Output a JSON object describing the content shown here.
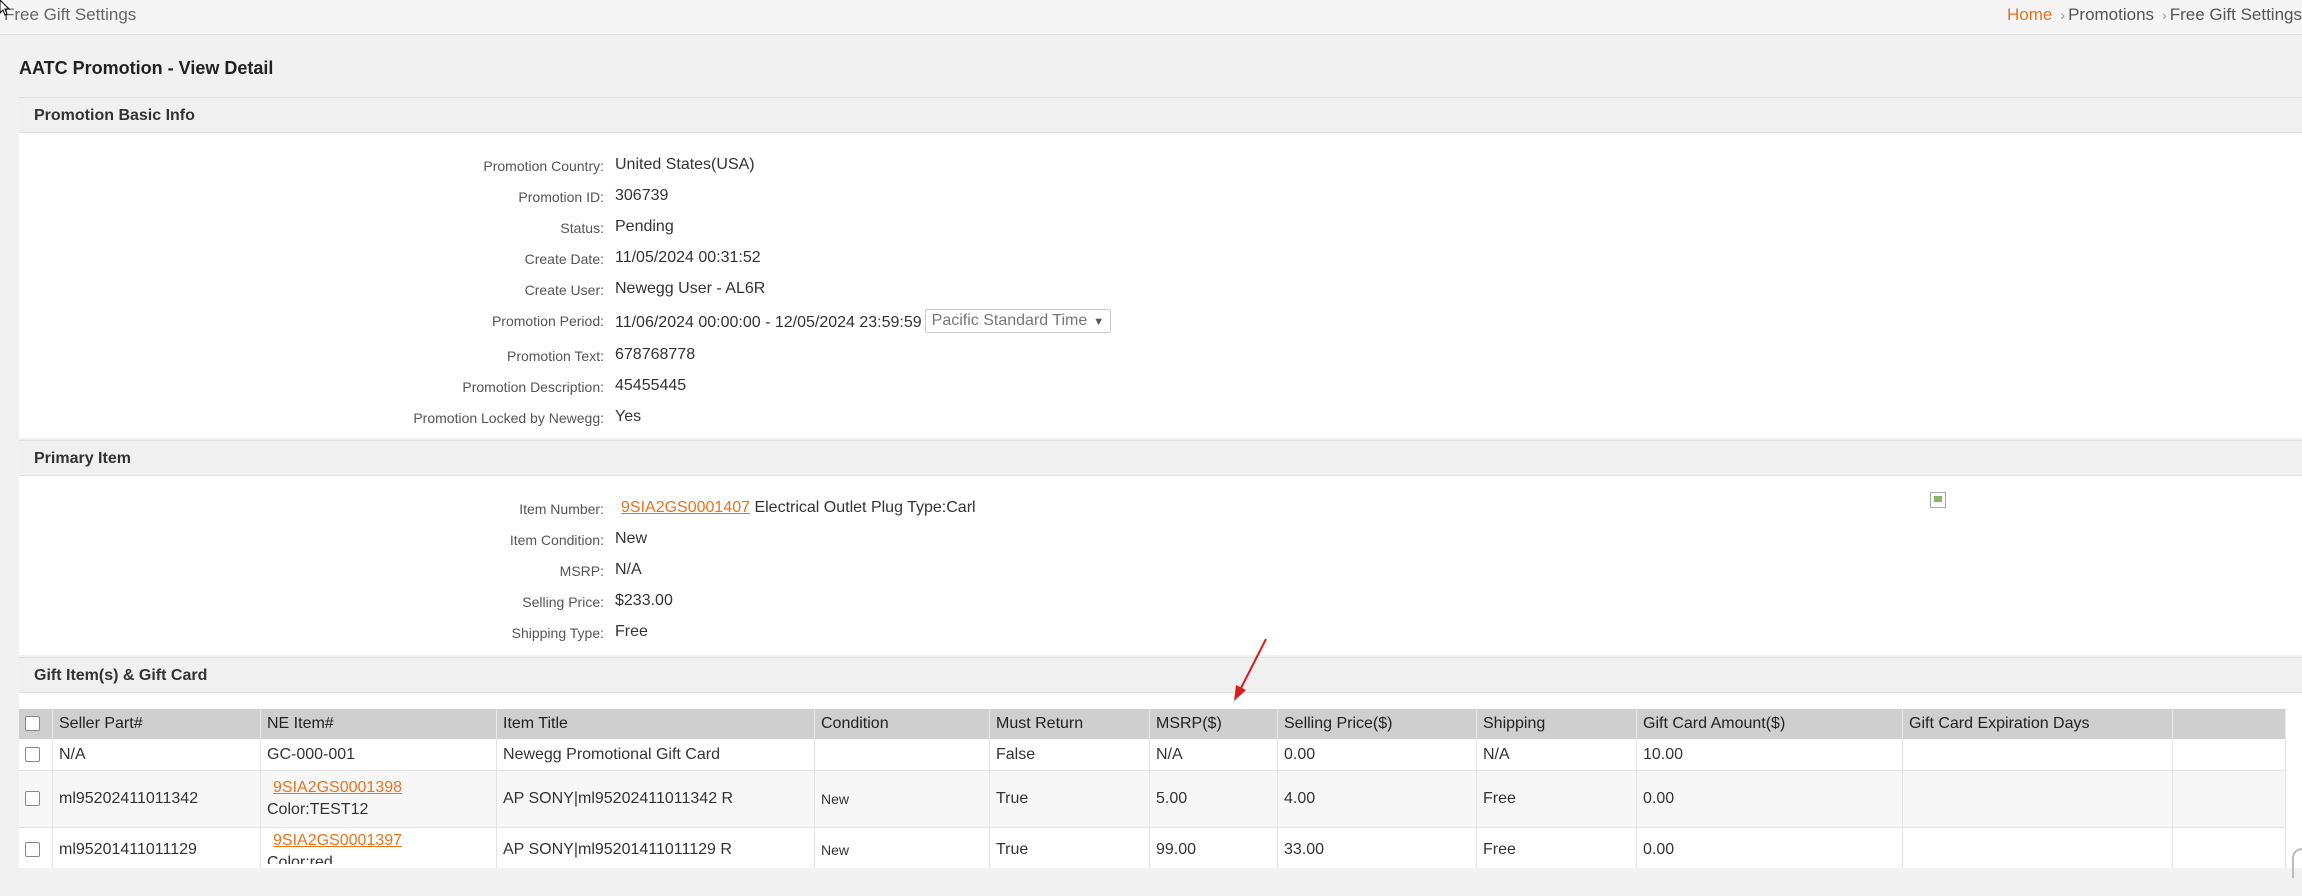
{
  "top": {
    "page_name": "Free Gift Settings",
    "breadcrumb": {
      "home": "Home",
      "promotions": "Promotions",
      "current": "Free Gift Settings"
    }
  },
  "page_title": "AATC Promotion - View Detail",
  "basic_info": {
    "header": "Promotion Basic Info",
    "fields": [
      {
        "label": "Promotion Country:",
        "value": "United States(USA)"
      },
      {
        "label": "Promotion ID:",
        "value": "306739"
      },
      {
        "label": "Status:",
        "value": "Pending"
      },
      {
        "label": "Create Date:",
        "value": "11/05/2024 00:31:52"
      },
      {
        "label": "Create User:",
        "value": "Newegg User - AL6R"
      },
      {
        "label": "Promotion Period:",
        "value": "11/06/2024 00:00:00 - 12/05/2024 23:59:59"
      },
      {
        "label": "Promotion Text:",
        "value": "678768778"
      },
      {
        "label": "Promotion Description:",
        "value": "45455445"
      },
      {
        "label": "Promotion Locked by Newegg:",
        "value": "Yes"
      }
    ],
    "timezone": "Pacific Standard Time"
  },
  "primary_item": {
    "header": "Primary Item",
    "item_number_label": "Item Number:",
    "item_number": "9SIA2GS0001407",
    "item_name": "Electrical Outlet Plug Type:Carl",
    "condition_label": "Item Condition:",
    "condition": "New",
    "msrp_label": "MSRP:",
    "msrp": "N/A",
    "price_label": "Selling Price:",
    "price": "$233.00",
    "shipping_label": "Shipping Type:",
    "shipping": "Free"
  },
  "gifts": {
    "header": "Gift Item(s) & Gift Card",
    "columns": [
      "Seller Part#",
      "NE Item#",
      "Item Title",
      "Condition",
      "Must Return",
      "MSRP($)",
      "Selling Price($)",
      "Shipping",
      "Gift Card Amount($)",
      "Gift Card Expiration Days"
    ],
    "rows": [
      {
        "seller_part": "N/A",
        "ne_item": "GC-000-001",
        "ne_item_sub": "",
        "title": "Newegg Promotional Gift Card",
        "condition": "",
        "must_return": "False",
        "msrp": "N/A",
        "price": "0.00",
        "shipping": "N/A",
        "gc_amount": "10.00",
        "gc_days": ""
      },
      {
        "seller_part": "ml95202411011342",
        "ne_item": "9SIA2GS0001398",
        "ne_item_sub": "Color:TEST12",
        "title": "AP SONY|ml95202411011342 R",
        "condition": "New",
        "must_return": "True",
        "msrp": "5.00",
        "price": "4.00",
        "shipping": "Free",
        "gc_amount": "0.00",
        "gc_days": ""
      },
      {
        "seller_part": "ml95201411011129",
        "ne_item": "9SIA2GS0001397",
        "ne_item_sub": "Color:red",
        "title": "AP SONY|ml95201411011129 R",
        "condition": "New",
        "must_return": "True",
        "msrp": "99.00",
        "price": "33.00",
        "shipping": "Free",
        "gc_amount": "0.00",
        "gc_days": ""
      }
    ]
  },
  "colors": {
    "accent": "#e8731c",
    "header_bg": "#f0f0f0",
    "table_header_bg": "#cfcfcf",
    "arrow": "#d81e1e"
  }
}
